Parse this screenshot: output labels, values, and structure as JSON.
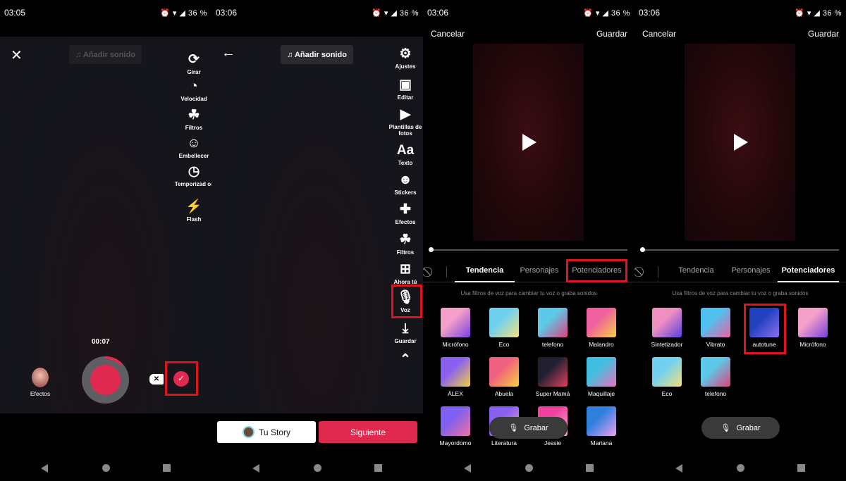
{
  "status_bars": [
    {
      "time": "03:05",
      "right": "⏰ ▾ ◢ 36 %"
    },
    {
      "time": "03:06",
      "right": "⏰ ▾ ◢ 36 %"
    },
    {
      "time": "03:06",
      "right": "⏰ ▾ ◢ 36 %"
    },
    {
      "time": "03:06",
      "right": "⏰ ▾ ◢ 36 %"
    }
  ],
  "panel1": {
    "add_sound": "♫ Añadir sonido",
    "tools": [
      {
        "icon": "⟳",
        "label": "Girar"
      },
      {
        "icon": "◔",
        "label": "Velocidad"
      },
      {
        "icon": "☘",
        "label": "Filtros"
      },
      {
        "icon": "☺",
        "label": "Embellecer"
      },
      {
        "icon": "◷",
        "label": "Temporizad or"
      },
      {
        "icon": "⚡",
        "label": "Flash"
      }
    ],
    "timer": "00:07",
    "effects_label": "Efectos",
    "progress_fraction": 0.1
  },
  "panel2": {
    "add_sound": "♫ Añadir sonido",
    "tools": [
      {
        "icon": "⚙",
        "label": "Ajustes"
      },
      {
        "icon": "▣",
        "label": "Editar"
      },
      {
        "icon": "▶",
        "label": "Plantillas de fotos"
      },
      {
        "icon": "Aa",
        "label": "Texto"
      },
      {
        "icon": "☻",
        "label": "Stickers"
      },
      {
        "icon": "✚",
        "label": "Efectos"
      },
      {
        "icon": "☘",
        "label": "Filtros"
      },
      {
        "icon": "⊞",
        "label": "Ahora tú"
      },
      {
        "icon": "🎙",
        "label": "Voz"
      },
      {
        "icon": "⤓",
        "label": "Guardar"
      },
      {
        "icon": "⌃",
        "label": ""
      }
    ],
    "story_button": "Tu Story",
    "next_button": "Siguiente"
  },
  "panel3": {
    "cancel": "Cancelar",
    "save": "Guardar",
    "tabs": [
      "Tendencia",
      "Personajes",
      "Potenciadores"
    ],
    "active_tab": 0,
    "hint": "Usa filtros de voz para cambiar tu voz o graba sonidos",
    "effects": [
      "Micrófono",
      "Eco",
      "telefono",
      "Malandro",
      "ÁLEX",
      "Abuela",
      "Super Mamá",
      "Maquillaje",
      "Mayordomo",
      "Literatura",
      "Jessie",
      "Mariana"
    ],
    "record": "Grabar"
  },
  "panel4": {
    "cancel": "Cancelar",
    "save": "Guardar",
    "tabs": [
      "Tendencia",
      "Personajes",
      "Potenciadores"
    ],
    "active_tab": 2,
    "hint": "Usa filtros de voz para cambiar tu voz o graba sonidos",
    "effects": [
      "Sintetizador",
      "Vibrato",
      "autotune",
      "Micrófono",
      "Eco",
      "telefono"
    ],
    "record": "Grabar"
  },
  "colors": {
    "accent": "#e0294f",
    "highlight_box": "#e0141e"
  }
}
